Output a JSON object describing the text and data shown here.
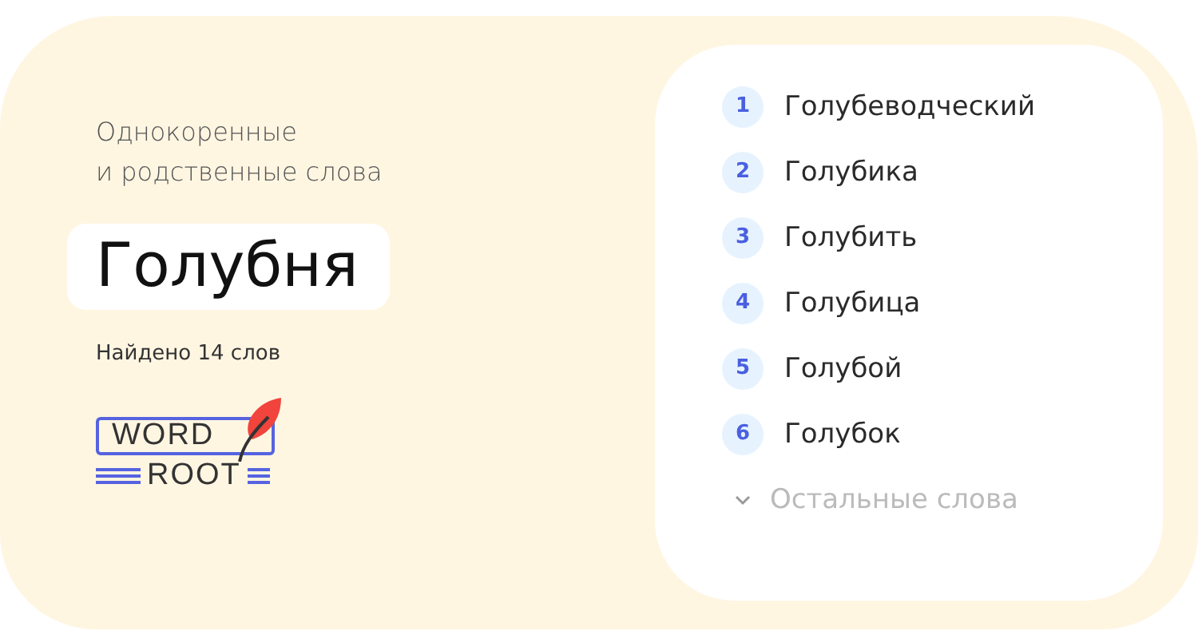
{
  "subtitle_lines": [
    "Однокоренные",
    "и родственные слова"
  ],
  "word": "Голубня",
  "found": "Найдено 14 слов",
  "logo": {
    "top": "WORD",
    "bottom": "ROOT"
  },
  "words": [
    {
      "number": "1",
      "text": "Голубеводческий"
    },
    {
      "number": "2",
      "text": "Голубика"
    },
    {
      "number": "3",
      "text": "Голубить"
    },
    {
      "number": "4",
      "text": "Голубица"
    },
    {
      "number": "5",
      "text": "Голубой"
    },
    {
      "number": "6",
      "text": "Голубок"
    }
  ],
  "more": {
    "label": "Остальные слова",
    "expanded": false
  }
}
